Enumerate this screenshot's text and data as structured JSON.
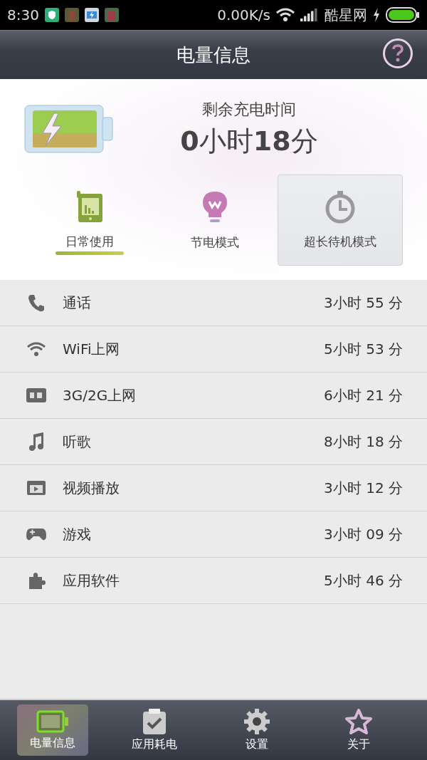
{
  "status_bar": {
    "time": "8:30",
    "speed": "0.00K/s",
    "carrier": "酷星网"
  },
  "header": {
    "title": "电量信息"
  },
  "summary": {
    "label": "剩余充电时间",
    "hours": "0",
    "hours_unit": "小时",
    "minutes": "18",
    "minutes_unit": "分"
  },
  "modes": [
    {
      "label": "日常使用",
      "selected": true,
      "pressed": false
    },
    {
      "label": "节电模式",
      "selected": false,
      "pressed": false
    },
    {
      "label": "超长待机模式",
      "selected": false,
      "pressed": true
    }
  ],
  "usage": [
    {
      "label": "通话",
      "time": "3小时 55 分"
    },
    {
      "label": "WiFi上网",
      "time": "5小时 53 分"
    },
    {
      "label": "3G/2G上网",
      "time": "6小时 21 分"
    },
    {
      "label": "听歌",
      "time": "8小时 18 分"
    },
    {
      "label": "视频播放",
      "time": "3小时 12 分"
    },
    {
      "label": "游戏",
      "time": "3小时 09 分"
    },
    {
      "label": "应用软件",
      "time": "5小时 46 分"
    }
  ],
  "tabs": [
    {
      "label": "电量信息",
      "selected": true
    },
    {
      "label": "应用耗电",
      "selected": false
    },
    {
      "label": "设置",
      "selected": false
    },
    {
      "label": "关于",
      "selected": false
    }
  ]
}
